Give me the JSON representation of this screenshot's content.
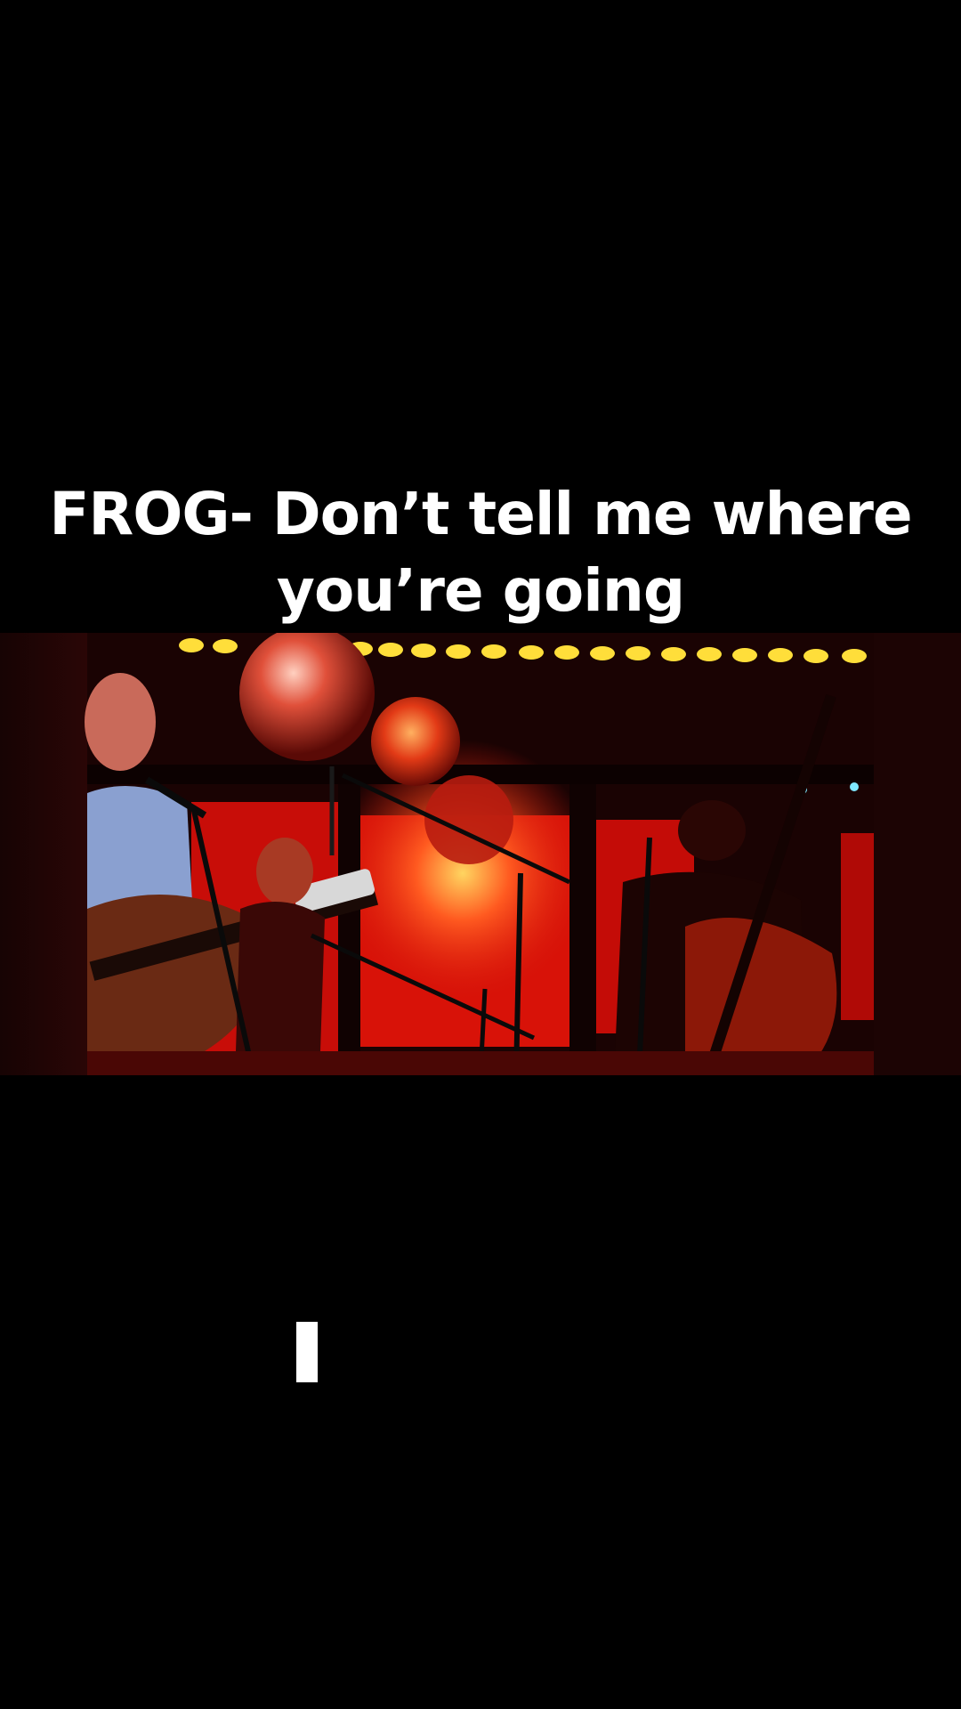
{
  "caption": {
    "line1": "FROG- Don’t tell me where",
    "line2": "you’re going"
  },
  "video": {
    "scene": "band-performing-on-red-lit-stage",
    "colors": {
      "backdrop": "#d4100a",
      "glow": "#ffcc44",
      "dark": "#140202",
      "letterbox": "#000000"
    }
  }
}
